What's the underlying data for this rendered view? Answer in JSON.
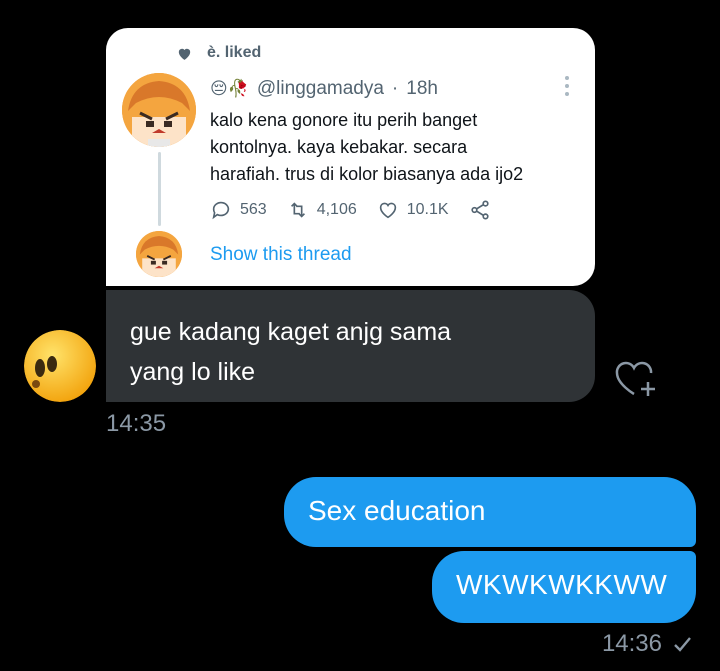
{
  "tweet": {
    "liked_label": "è. liked",
    "author_emojis": "😔🥀",
    "handle": "@linggamadya",
    "separator": "·",
    "age": "18h",
    "text_lines": [
      "kalo kena gonore itu perih banget",
      "kontolnya. kaya kebakar. secara",
      "harafiah. trus di kolor biasanya ada ijo2"
    ],
    "replies": "563",
    "retweets": "4,106",
    "likes": "10.1K",
    "show_thread": "Show this thread"
  },
  "incoming_message": {
    "lines": [
      "gue kadang kaget anjg sama",
      "yang lo like"
    ],
    "time": "14:35"
  },
  "outgoing_messages": [
    {
      "text": "Sex education"
    },
    {
      "text": "WKWKWKKWW"
    }
  ],
  "outgoing_time": "14:36",
  "colors": {
    "background": "#000000",
    "incoming_bubble": "#2f3336",
    "outgoing_bubble": "#1d9bf0",
    "link": "#1d9bf0",
    "muted": "#8b98a5"
  },
  "icons": [
    "heart-icon",
    "more-icon",
    "reply-icon",
    "retweet-icon",
    "like-icon",
    "share-icon",
    "add-reaction-icon",
    "sent-check-icon"
  ]
}
